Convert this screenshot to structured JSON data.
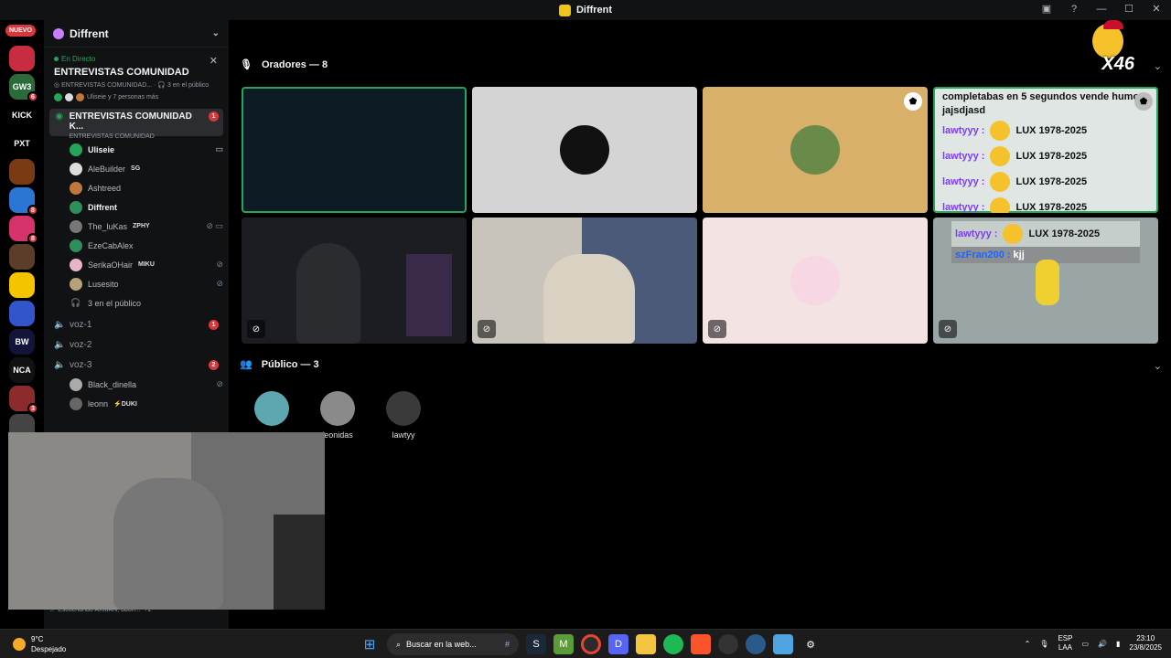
{
  "window": {
    "title": "Diffrent"
  },
  "rail": {
    "new_label": "NUEVO",
    "servers": [
      {
        "label": "",
        "color": "#c72c41",
        "badge": ""
      },
      {
        "label": "GW3",
        "color": "#2b6b3a",
        "badge": "6"
      },
      {
        "label": "KICK",
        "color": "#000000",
        "badge": ""
      },
      {
        "label": "PXT",
        "color": "#000000",
        "badge": ""
      },
      {
        "label": "",
        "color": "#7a3b14",
        "badge": ""
      },
      {
        "label": "",
        "color": "#2a76d2",
        "badge": "8"
      },
      {
        "label": "",
        "color": "#d6336c",
        "badge": "8"
      },
      {
        "label": "",
        "color": "#5b3d2a",
        "badge": ""
      },
      {
        "label": "",
        "color": "#f5c400",
        "badge": ""
      },
      {
        "label": "",
        "color": "#3355cc",
        "badge": ""
      },
      {
        "label": "BW",
        "color": "#14143a",
        "badge": ""
      },
      {
        "label": "NCA",
        "color": "#111111",
        "badge": ""
      },
      {
        "label": "",
        "color": "#8c2b2b",
        "badge": "3"
      },
      {
        "label": "",
        "color": "#444444",
        "badge": ""
      }
    ]
  },
  "sidebar": {
    "guild_name": "Diffrent",
    "live": {
      "tag": "En Directo",
      "title": "ENTREVISTAS COMUNIDAD",
      "sub_channel": "ENTREVISTAS COMUNIDAD...",
      "sub_audience": "3 en el público",
      "people": "Uliseie y 7 personas más"
    },
    "active_channel": {
      "name": "ENTREVISTAS COMUNIDAD K...",
      "sub": "ENTREVISTAS COMUNIDAD",
      "badge": "1"
    },
    "members": [
      {
        "name": "Uliseie",
        "tag": "",
        "color": "#23a55a",
        "bright": true,
        "icons": "▭"
      },
      {
        "name": "AleBuilder",
        "tag": "SG",
        "color": "#ddd",
        "bright": false,
        "icons": ""
      },
      {
        "name": "Ashtreed",
        "tag": "",
        "color": "#c0773a",
        "bright": false,
        "icons": ""
      },
      {
        "name": "Diffrent",
        "tag": "",
        "color": "#2f8f5b",
        "bright": true,
        "icons": ""
      },
      {
        "name": "The_luKas",
        "tag": "ZPHY",
        "color": "#777",
        "bright": false,
        "icons": "⊘ ▭"
      },
      {
        "name": "EzeCabAlex",
        "tag": "",
        "color": "#2f8f5b",
        "bright": false,
        "icons": ""
      },
      {
        "name": "SerikaOHair",
        "tag": "MIKU",
        "color": "#e8b4c8",
        "bright": false,
        "icons": "⊘"
      },
      {
        "name": "Lusesito",
        "tag": "",
        "color": "#b5a27a",
        "bright": false,
        "icons": "⊘"
      }
    ],
    "audience_row": "3 en el público",
    "voice_channels": [
      {
        "name": "voz-1",
        "badge": "1"
      },
      {
        "name": "voz-2",
        "badge": ""
      },
      {
        "name": "voz-3",
        "badge": "2"
      }
    ],
    "voz3_members": [
      {
        "name": "Black_dinella",
        "tag": "",
        "color": "#aaa",
        "icons": "⊘"
      },
      {
        "name": "leonn",
        "tag": "DUKI",
        "color": "#666",
        "icons": ""
      }
    ],
    "activity": "Escuchando AXMAN, bbon...",
    "activity_count": "+2"
  },
  "main": {
    "speakers_header": "Oradores — 8",
    "audience_header": "Público — 3",
    "overlay_text": "X46",
    "chat": {
      "header": "completabas en 5 segundos vende humo",
      "header2": "jajsdjasd",
      "lines": [
        {
          "who": "lawtyyy :",
          "msg": "LUX 1978-2025"
        },
        {
          "who": "lawtyyy :",
          "msg": "LUX 1978-2025"
        },
        {
          "who": "lawtyyy :",
          "msg": "LUX 1978-2025"
        },
        {
          "who": "lawtyyy :",
          "msg": "LUX 1978-2025"
        }
      ],
      "line5_who": "lawtyyy :",
      "line5_msg": "LUX 1978-2025",
      "line6_who": "szFran200 :",
      "line6_msg": "kjj"
    },
    "audience": [
      {
        "name": "",
        "color": "#5fa7b0"
      },
      {
        "name": "leonidas",
        "color": "#8a8a8a"
      },
      {
        "name": "lawtyy",
        "color": "#3a3a3a"
      }
    ]
  },
  "taskbar": {
    "temp": "9°C",
    "weather": "Despejado",
    "search_placeholder": "Buscar en la web...",
    "lang1": "ESP",
    "lang2": "LAA",
    "time": "23:10",
    "date": "23/8/2025"
  }
}
